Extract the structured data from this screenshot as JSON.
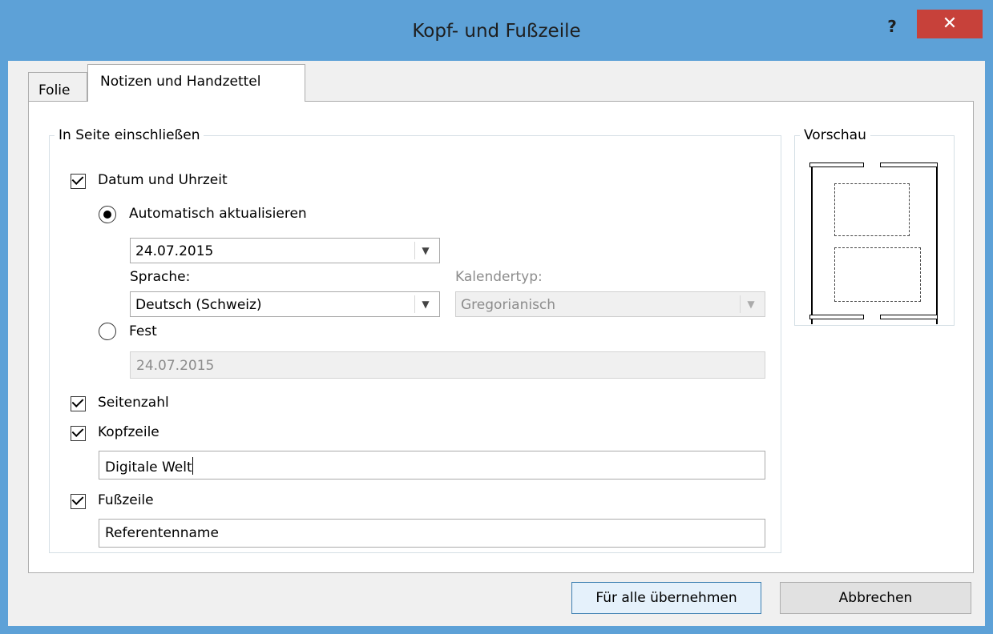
{
  "window": {
    "title": "Kopf- und Fußzeile",
    "help_label": "?",
    "close_label": "✕"
  },
  "tabs": [
    {
      "label": "Folie",
      "selected": false
    },
    {
      "label": "Notizen und Handzettel",
      "selected": true
    }
  ],
  "include_group": {
    "legend": "In Seite einschließen",
    "date_time": {
      "label": "Datum und Uhrzeit",
      "checked": true
    },
    "auto_update": {
      "label": "Automatisch aktualisieren",
      "selected": true,
      "value": "24.07.2015"
    },
    "language": {
      "label": "Sprache:",
      "value": "Deutsch (Schweiz)"
    },
    "calendar": {
      "label": "Kalendertyp:",
      "value": "Gregorianisch",
      "enabled": false
    },
    "fixed": {
      "label": "Fest",
      "selected": false,
      "value": "24.07.2015"
    },
    "page_number": {
      "label": "Seitenzahl",
      "checked": true
    },
    "header": {
      "label": "Kopfzeile",
      "checked": true,
      "value": "Digitale Welt"
    },
    "footer": {
      "label": "Fußzeile",
      "checked": true,
      "value": "Referentenname"
    }
  },
  "preview": {
    "legend": "Vorschau"
  },
  "buttons": {
    "apply_all": "Für alle übernehmen",
    "cancel": "Abbrechen"
  },
  "colors": {
    "titlebar": "#5da1d7",
    "close": "#c7413a",
    "dialog": "#f0f0f0",
    "default_button_border": "#3c7fb1"
  }
}
